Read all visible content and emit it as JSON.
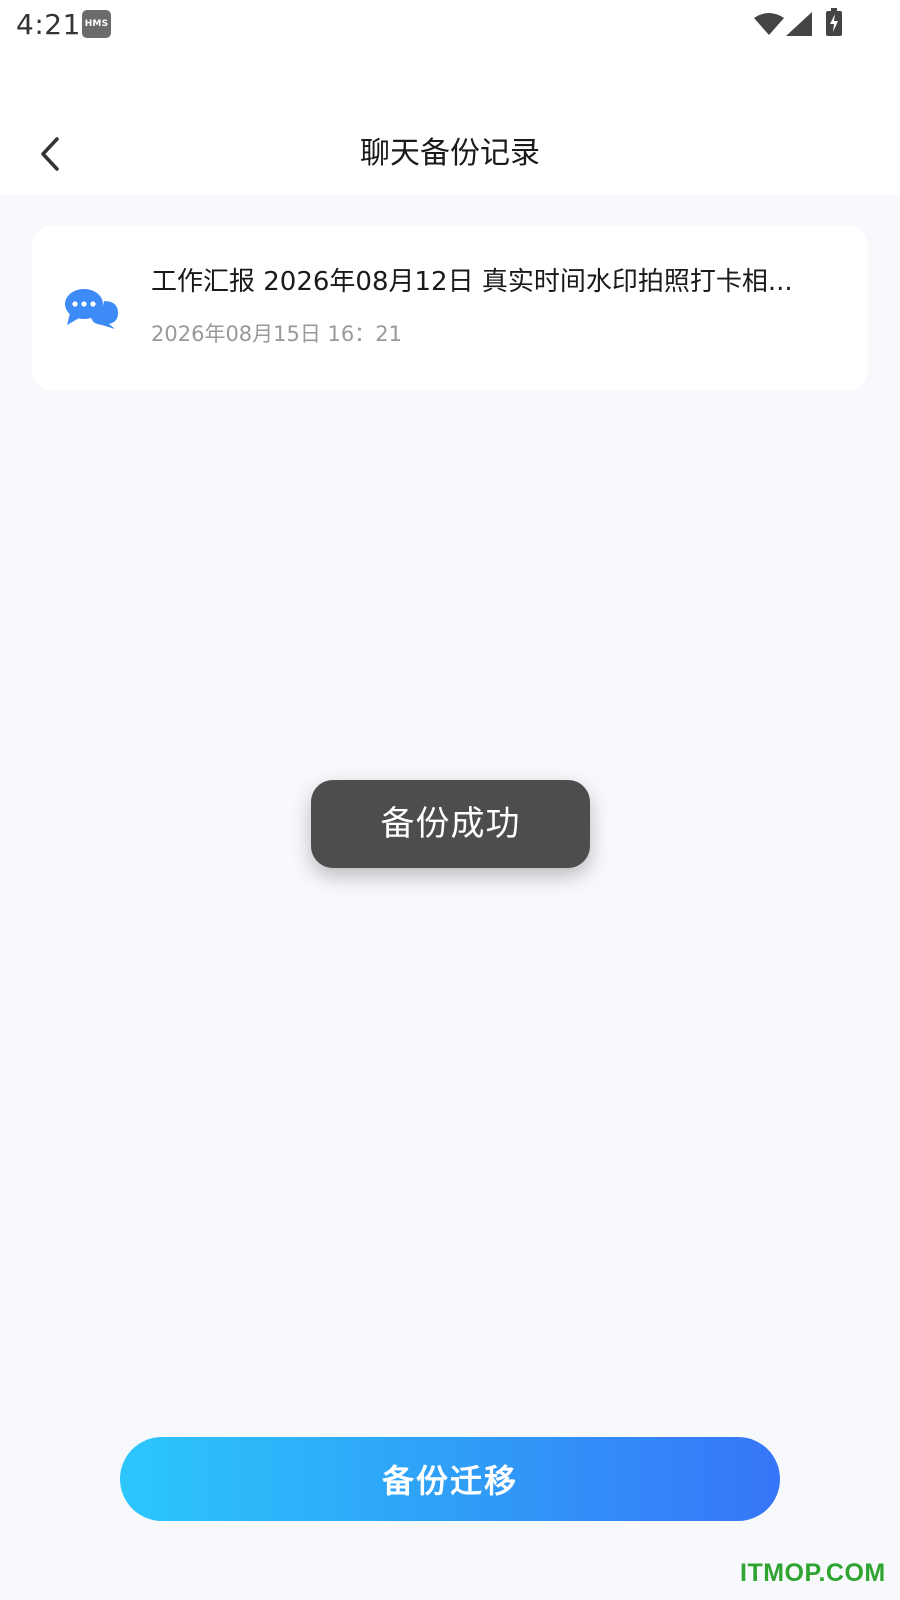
{
  "status_bar": {
    "time": "4:21",
    "badge": "HMS",
    "icons": [
      "wifi-icon",
      "signal-icon",
      "battery-charging-icon"
    ]
  },
  "header": {
    "back_icon": "chevron-left-icon",
    "title": "聊天备份记录"
  },
  "records": [
    {
      "icon": "chat-bubbles-icon",
      "title": "工作汇报 2026年08月12日 真实时间水印拍照打卡相...",
      "time": "2026年08月15日  16：21"
    }
  ],
  "toast": {
    "message": "备份成功"
  },
  "footer": {
    "migrate_label": "备份迁移"
  },
  "watermark": "ITMOP.COM",
  "colors": {
    "icon_blue": "#3d8bf7",
    "button_gradient_start": "#2cc7fc",
    "button_gradient_end": "#3775f8",
    "toast_bg": "#4d4d4d",
    "watermark_green": "#2fa530"
  }
}
